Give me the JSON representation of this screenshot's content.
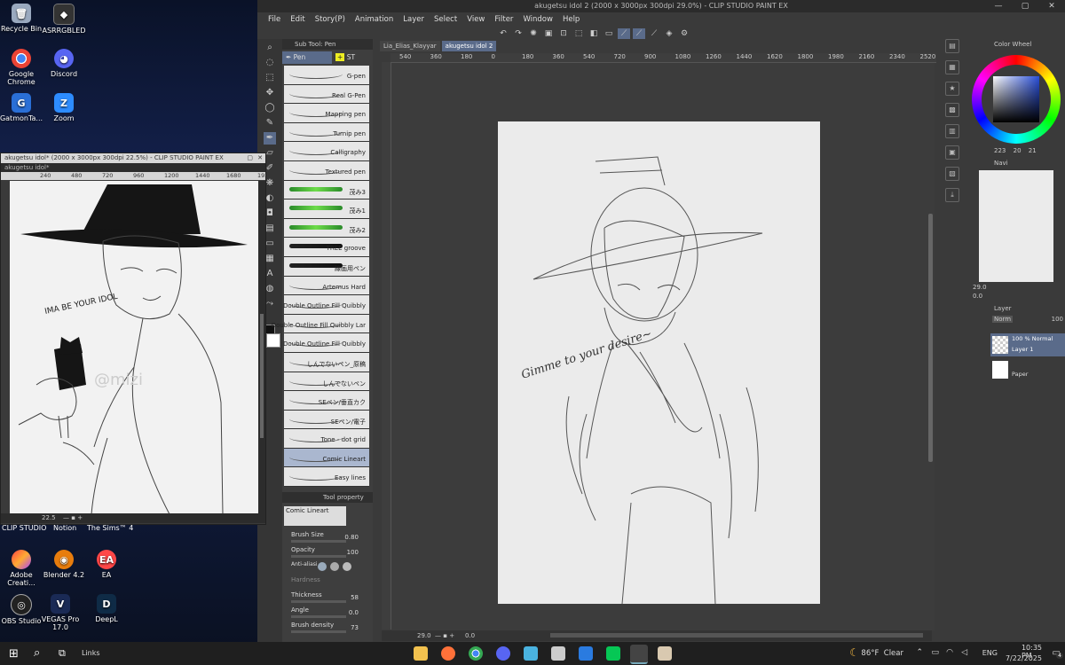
{
  "desktop": {
    "icons_left": [
      {
        "label": "Recycle Bin",
        "icon": "recycle-bin-icon"
      },
      {
        "label": "Google Chrome",
        "icon": "chrome-icon"
      },
      {
        "label": "GatmonTa...",
        "icon": "app-icon"
      }
    ],
    "icons_col2": [
      {
        "label": "ASRRGBLED",
        "icon": "asr-rgb-icon"
      },
      {
        "label": "Discord",
        "icon": "discord-icon"
      },
      {
        "label": "Zoom",
        "icon": "zoom-icon"
      }
    ],
    "icons_bottom": [
      {
        "label": "CLIP STUDIO",
        "icon": "clip-studio-icon"
      },
      {
        "label": "Notion",
        "icon": "notion-icon"
      },
      {
        "label": "The Sims™ 4",
        "icon": "sims-icon"
      },
      {
        "label": "Adobe Creati...",
        "icon": "adobe-cc-icon"
      },
      {
        "label": "Blender 4.2",
        "icon": "blender-icon"
      },
      {
        "label": "EA",
        "icon": "ea-icon"
      },
      {
        "label": "OBS Studio",
        "icon": "obs-icon"
      },
      {
        "label": "VEGAS Pro 17.0",
        "icon": "vegas-icon"
      },
      {
        "label": "DeepL",
        "icon": "deepl-icon"
      }
    ]
  },
  "main_window": {
    "title": "akugetsu idol 2 (2000 x 3000px 300dpi 29.0%) - CLIP STUDIO PAINT EX",
    "menu": [
      "File",
      "Edit",
      "Story(P)",
      "Animation",
      "Layer",
      "Select",
      "View",
      "Filter",
      "Window",
      "Help"
    ],
    "tabs": [
      "Lia_Elias_Klayyar",
      "akugetsu idol 2"
    ],
    "ruler_top": [
      "540",
      "360",
      "180",
      "0",
      "180",
      "360",
      "540",
      "720",
      "900",
      "1080",
      "1260",
      "1440",
      "1620",
      "1800",
      "1980",
      "2160",
      "2340",
      "2520"
    ],
    "zoom": "29.0",
    "rotation": "0.0",
    "sketch_text": "Gimme to your desire~"
  },
  "subtool": {
    "header": "Sub Tool: Pen",
    "tab_pen": "Pen",
    "tab_st": "ST",
    "brushes": [
      "G-pen",
      "Real G-Pen",
      "Mapping pen",
      "Turnip pen",
      "Calligraphy",
      "Textured pen",
      "茂み3",
      "茂み1",
      "茂み2",
      "TREE groove",
      "線画用ペン",
      "Artemus Hard",
      "Double Outline Fill Quibbly",
      "Double Outline Fill Quibbly Lar",
      "Double Outline Fill Quibbly",
      "しんでないペン_原稿",
      "しんでないペン",
      "SEペン/垂直カク",
      "SEペン/電子",
      "Tone - dot grid",
      "Comic Lineart",
      "Easy lines"
    ],
    "selected": "Comic Lineart"
  },
  "tool_property": {
    "header": "Tool property",
    "preset_name": "Comic Lineart",
    "brush_size": {
      "label": "Brush Size",
      "value": "0.80"
    },
    "opacity": {
      "label": "Opacity",
      "value": "100"
    },
    "anti_alias": {
      "label": "Anti-aliasi"
    },
    "hardness": {
      "label": "Hardness"
    },
    "thickness": {
      "label": "Thickness",
      "value": "58"
    },
    "angle": {
      "label": "Angle",
      "value": "0.0"
    },
    "brush_density": {
      "label": "Brush density",
      "value": "73"
    }
  },
  "color_wheel": {
    "title": "Color Wheel",
    "h": "223",
    "s": "20",
    "v": "21"
  },
  "navigator": {
    "title": "Navi",
    "zoom": "29.0",
    "rotation": "0.0"
  },
  "layers": {
    "title": "Layer",
    "blend": "Norm",
    "opacity": "100",
    "items": [
      {
        "info": "100 % Normal",
        "name": "Layer 1",
        "selected": true
      },
      {
        "info": "",
        "name": "Paper",
        "selected": false
      }
    ]
  },
  "float_window": {
    "title": "akugetsu idol* (2000 x 3000px 300dpi 22.5%) - CLIP STUDIO PAINT EX",
    "tab": "akugetsu idol*",
    "ruler": [
      "240",
      "480",
      "720",
      "960",
      "1200",
      "1440",
      "1680",
      "192"
    ],
    "zoom": "22.5",
    "art_text": "IMA BE YOUR IDOL",
    "watermark": "@mizi"
  },
  "taskbar": {
    "search_label": "Links",
    "weather": "86°F  Clear",
    "lang": "ENG",
    "time": "10:35 PM",
    "date": "7/22/2025",
    "notifications": "4"
  },
  "colors": {
    "accent": "#5a6b8a",
    "panel": "#3a3a3a",
    "selected_brush": "#aab7cf"
  }
}
